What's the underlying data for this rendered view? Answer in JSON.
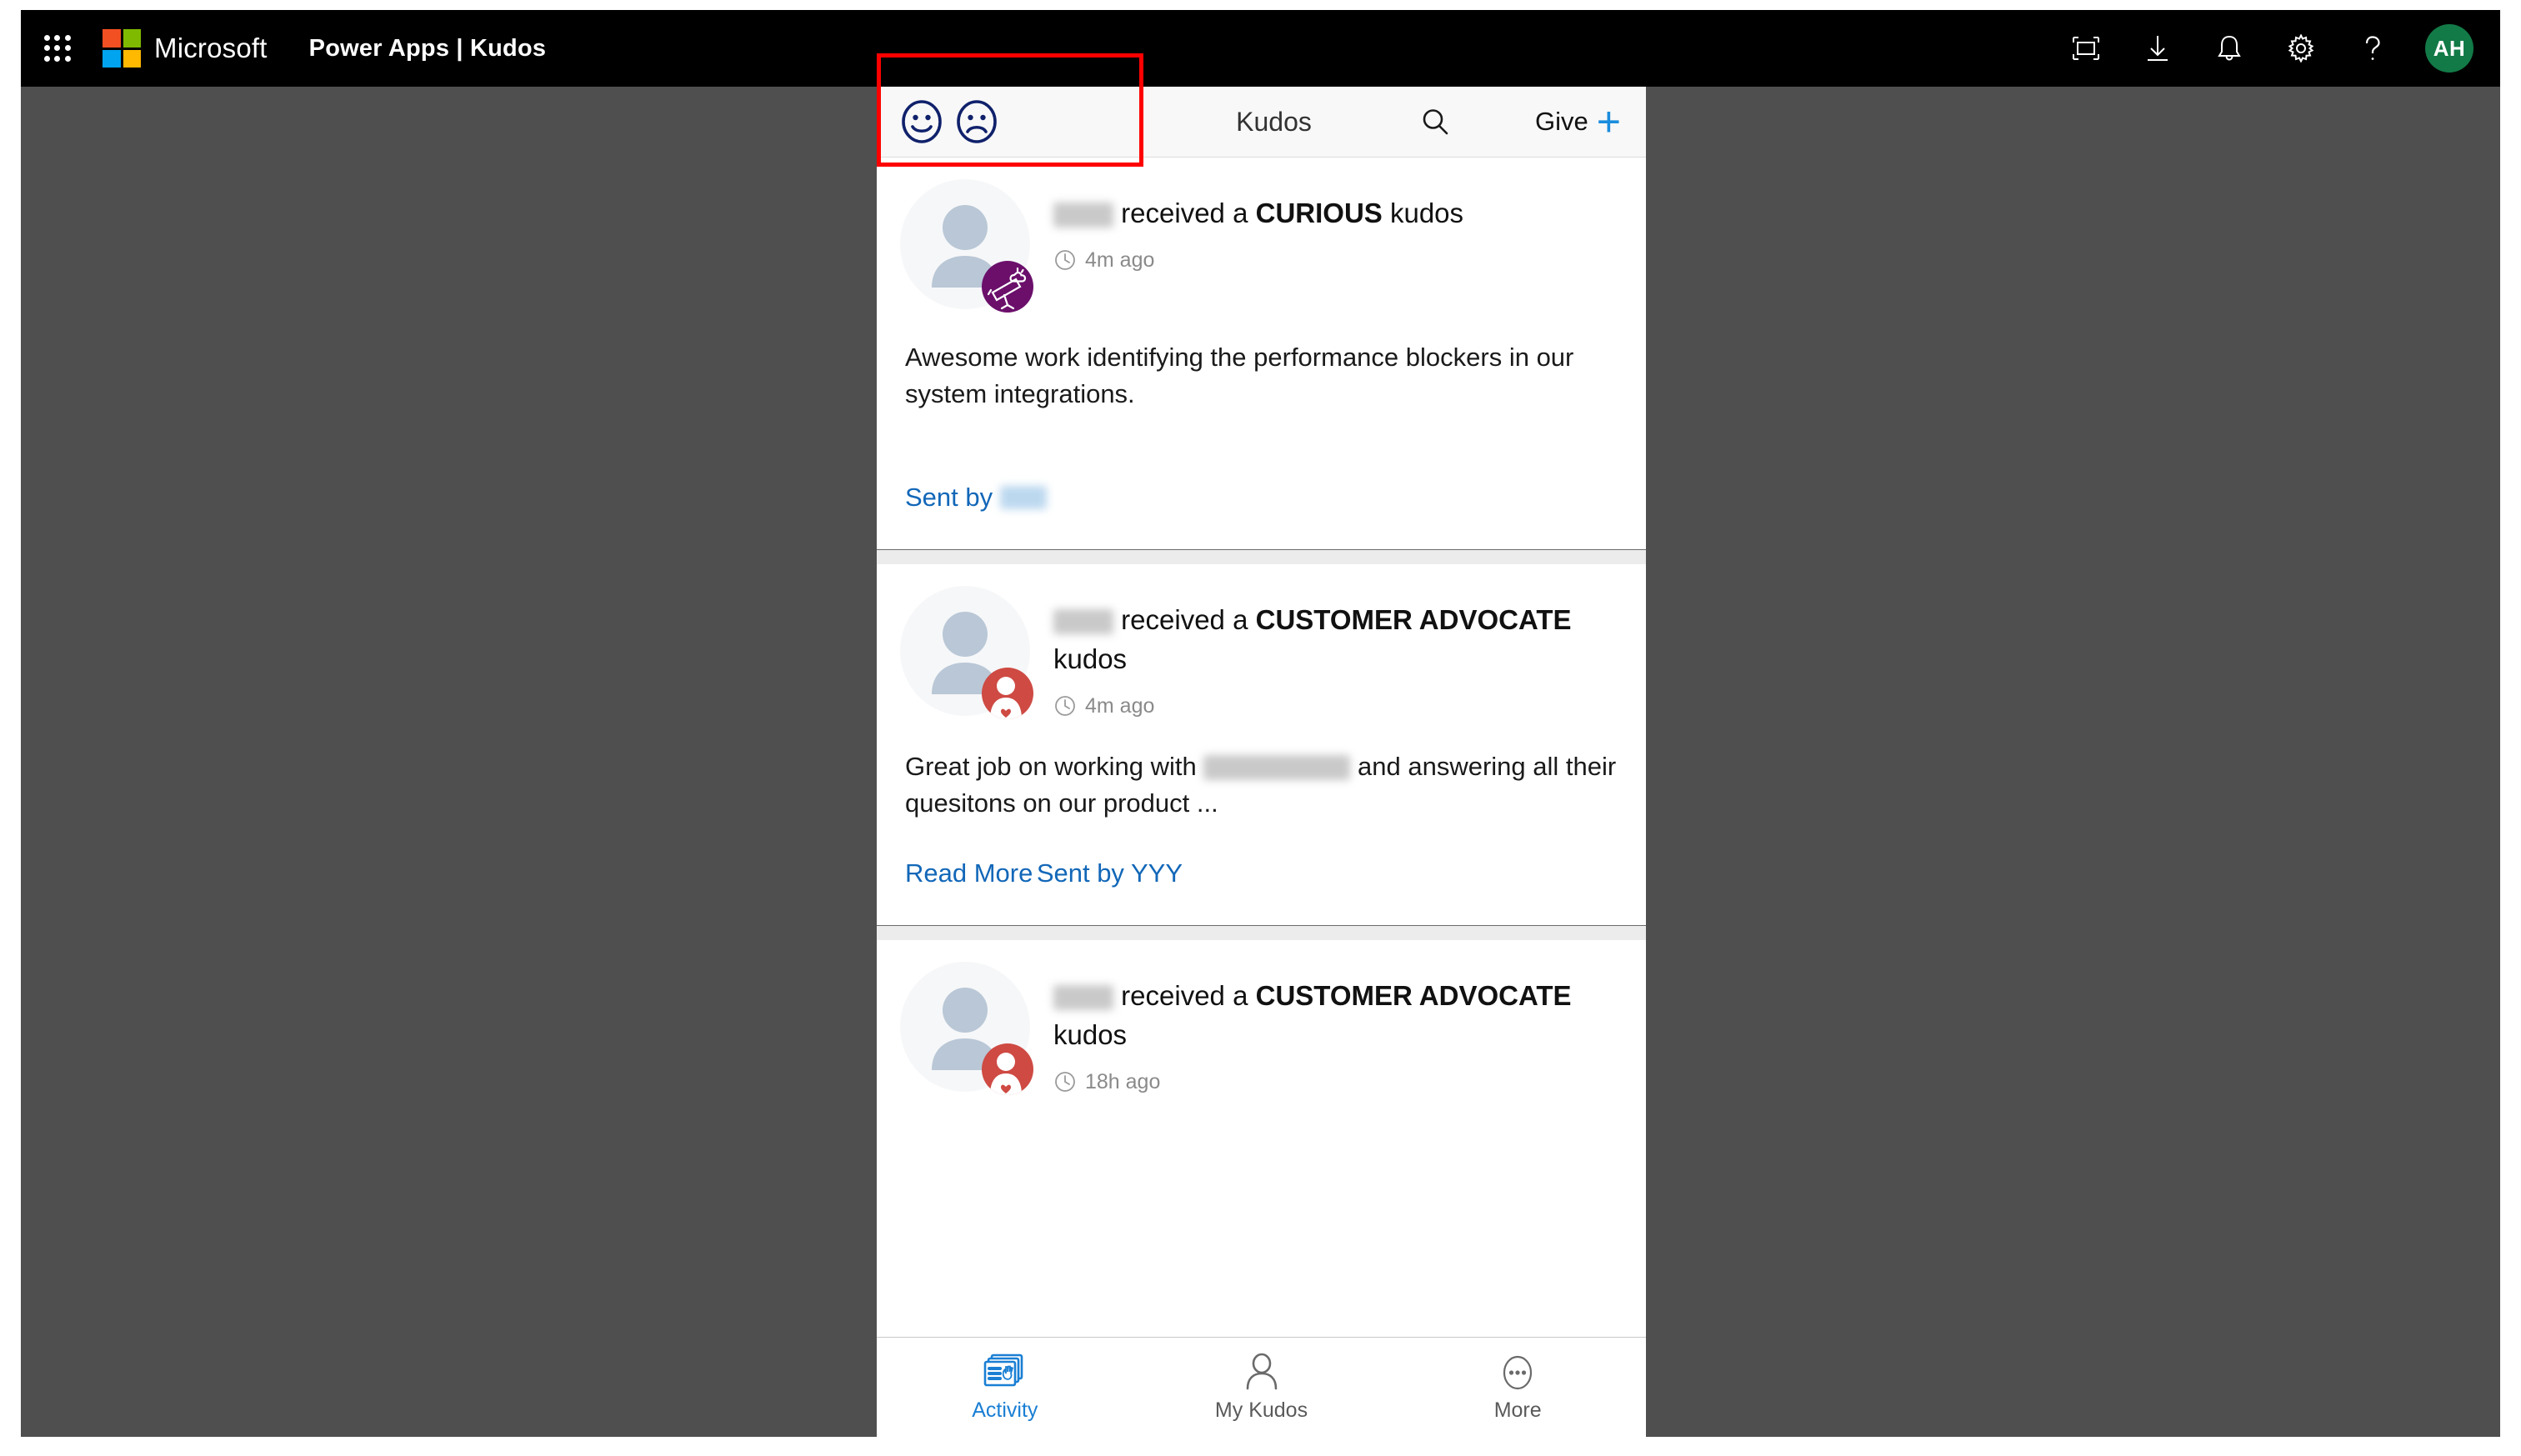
{
  "suite_bar": {
    "waffle_icon": "waffle-grid-icon",
    "brand": "Microsoft",
    "app_title": "Power Apps  |  Kudos",
    "icons": [
      {
        "name": "fullscreen-icon",
        "label": "Fullscreen"
      },
      {
        "name": "download-icon",
        "label": "Download"
      },
      {
        "name": "bell-icon",
        "label": "Notifications"
      },
      {
        "name": "gear-icon",
        "label": "Settings"
      },
      {
        "name": "help-icon",
        "label": "Help"
      }
    ],
    "avatar_initials": "AH",
    "avatar_color": "#127a47"
  },
  "app_header": {
    "mood_happy_icon": "smiley-face-icon",
    "mood_sad_icon": "frowny-face-icon",
    "title": "Kudos",
    "search_icon": "search-icon",
    "give_label": "Give",
    "give_plus": "+",
    "accent_color": "#1a8cdd",
    "mood_icon_color": "#10216b"
  },
  "annotation": {
    "color": "#ff0000",
    "target": "mood-selector-highlight"
  },
  "feed": {
    "cards": [
      {
        "recipient": "",
        "headline_prefix": "received a",
        "kudos_type": "CURIOUS",
        "headline_suffix": "kudos",
        "badge": "telescope-icon",
        "badge_color": "#6b0f6b",
        "time": "4m ago",
        "message": "Awesome work identifying the performance blockers in our system integrations.",
        "read_more": null,
        "sent_by_label": "Sent by",
        "sent_by_name": "",
        "sent_by_redacted": true
      },
      {
        "recipient": "",
        "headline_prefix": "received a",
        "kudos_type": "CUSTOMER ADVOCATE",
        "headline_suffix": "kudos",
        "badge": "customer-advocate-icon",
        "badge_color": "#ce4a43",
        "time": "4m ago",
        "message_before": "Great job on working with",
        "message_after": "and answering all their quesitons on our product ...",
        "read_more": "Read More",
        "sent_by_label": "Sent by",
        "sent_by_name": "YYY",
        "sent_by_redacted": false
      },
      {
        "recipient": "",
        "headline_prefix": "received a",
        "kudos_type": "CUSTOMER ADVOCATE",
        "headline_suffix": "kudos",
        "badge": "customer-advocate-icon",
        "badge_color": "#ce4a43",
        "time": "18h ago"
      }
    ]
  },
  "bottom_nav": {
    "items": [
      {
        "label": "Activity",
        "icon": "activity-clap-icon",
        "active": true
      },
      {
        "label": "My Kudos",
        "icon": "person-icon",
        "active": false
      },
      {
        "label": "More",
        "icon": "ellipsis-icon",
        "active": false
      }
    ],
    "active_color": "#1a7fd4"
  }
}
